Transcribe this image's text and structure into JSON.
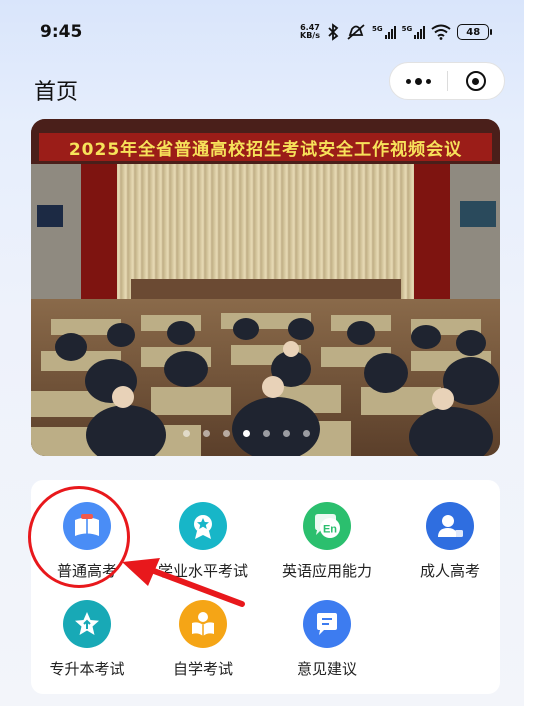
{
  "status_bar": {
    "time": "9:45",
    "net_speed_top": "6.47",
    "net_speed_unit": "KB/s",
    "sig1_label": "5G",
    "sig2_label": "5G",
    "battery": "48"
  },
  "header": {
    "title": "首页"
  },
  "banner": {
    "title": "2025年全省普通高校招生考试安全工作视频会议",
    "slide_count": 7,
    "active_slide": 3
  },
  "menu": {
    "items": [
      {
        "label": "普通高考",
        "icon": "book-icon",
        "color": "#4a8df6"
      },
      {
        "label": "学业水平考试",
        "icon": "medal-icon",
        "color": "#17b6c8"
      },
      {
        "label": "英语应用能力",
        "icon": "en-chat-icon",
        "color": "#2bbf6e"
      },
      {
        "label": "成人高考",
        "icon": "person-icon",
        "color": "#2f6ee0"
      },
      {
        "label": "专升本考试",
        "icon": "star-icon",
        "color": "#18a9b6"
      },
      {
        "label": "自学考试",
        "icon": "reading-icon",
        "color": "#f5a516"
      },
      {
        "label": "意见建议",
        "icon": "message-icon",
        "color": "#3d7cf0"
      }
    ]
  },
  "colors": {
    "annotation": "#e8181c"
  }
}
